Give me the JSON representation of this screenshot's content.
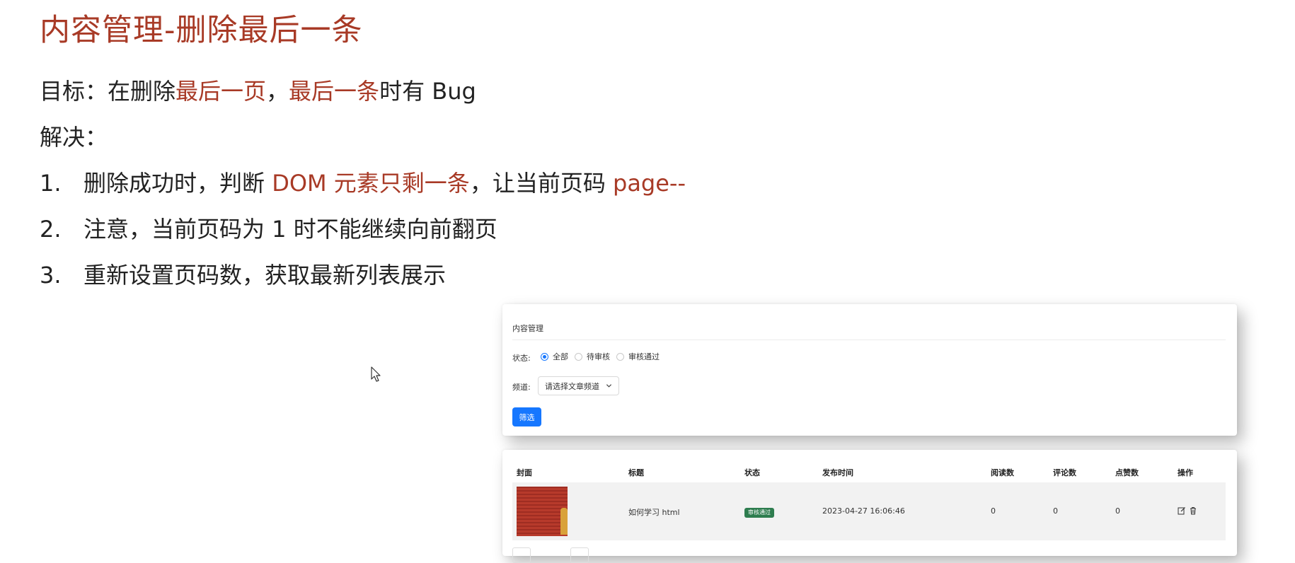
{
  "slide": {
    "title": "内容管理-删除最后一条",
    "goal": {
      "prefix": "目标：在删除",
      "highlight1": "最后一页",
      "sep": "，",
      "highlight2": "最后一条",
      "suffix": "时有 Bug"
    },
    "solution_label": "解决：",
    "steps": [
      {
        "num": "1.",
        "prefix": "删除成功时，判断 ",
        "highlight1": "DOM 元素只剩一条",
        "middle": "，让当前页码 ",
        "highlight2": "page--"
      },
      {
        "num": "2.",
        "text": "注意，当前页码为 1 时不能继续向前翻页"
      },
      {
        "num": "3.",
        "text": "重新设置页码数，获取最新列表展示"
      }
    ],
    "colors": {
      "accent": "#a83a26",
      "text": "#222222"
    }
  },
  "app": {
    "breadcrumb": "内容管理",
    "status_label": "状态:",
    "status_options": [
      "全部",
      "待审核",
      "审核通过"
    ],
    "status_selected": "全部",
    "channel_label": "频道:",
    "channel_placeholder": "请选择文章频道",
    "filter_button": "筛选",
    "colors": {
      "primary": "#1677ff",
      "badge_success": "#2e7d4f"
    },
    "table": {
      "headers": [
        "封面",
        "标题",
        "状态",
        "发布时间",
        "阅读数",
        "评论数",
        "点赞数",
        "操作"
      ],
      "rows": [
        {
          "title": "如何学习 html",
          "status": "审核通过",
          "publish_time": "2023-04-27 16:06:46",
          "reads": "0",
          "comments": "0",
          "likes": "0",
          "actions": [
            "edit-icon",
            "delete-icon"
          ]
        }
      ]
    }
  }
}
